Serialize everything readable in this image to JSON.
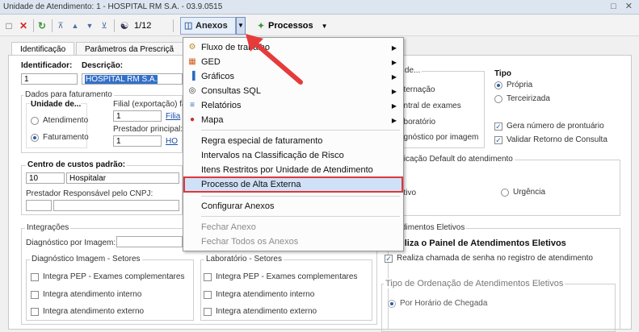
{
  "window": {
    "title": "Unidade de Atendimento: 1 - HOSPITAL RM S.A. - 03.9.0515",
    "controls": "□ ✕"
  },
  "toolbar": {
    "counter": "1/12",
    "anexos_label": "Anexos",
    "processos_label": "Processos"
  },
  "tabs": [
    "Identificação",
    "Parâmetros da Prescriçã"
  ],
  "ident": {
    "identificador_label": "Identificador:",
    "identificador_value": "1",
    "descricao_label": "Descrição:",
    "descricao_value": "HOSPITAL RM S.A."
  },
  "faturamento": {
    "title": "Dados para faturamento",
    "unidade_label": "Unidade de...",
    "atendimento": "Atendimento",
    "faturamento": "Faturamento",
    "filial_label": "Filial (exportação) fa",
    "filial_value": "1",
    "filial_link": "Filia",
    "prestador_label": "Prestador principal:",
    "prestador_value": "1",
    "prestador_link": "HO"
  },
  "centro": {
    "title": "Centro de custos padrão:",
    "code": "10",
    "name": "Hospitalar",
    "prest_label": "Prestador Responsável pelo CNPJ:"
  },
  "integracoes": {
    "title": "Integrações",
    "diag_label": "Diagnóstico por Imagem:",
    "diag_setores": "Diagnóstico Imagem - Setores",
    "lab_setores": "Laboratório - Setores",
    "items_left": [
      "Integra PEP - Exames complementares",
      "Integra atendimento interno",
      "Integra atendimento externo"
    ],
    "items_right": [
      "Integra PEP - Exames complementares",
      "Integra atendimento interno",
      "Integra atendimento externo"
    ]
  },
  "right": {
    "unidade_title": "de de...",
    "unidade_opts": [
      "nternação",
      "entral de exames",
      "aboratório",
      "agnóstico por imagem"
    ],
    "tipo_title": "Tipo",
    "tipo_opts": [
      "Própria",
      "Terceirizada"
    ],
    "checks": [
      "Gera número de prontuário",
      "Validar Retorno de Consulta"
    ],
    "classif_title": "ficação Default do atendimento",
    "eletivo": "etivo",
    "urgencia": "Urgência",
    "eletivos_title": "dimentos Eletivos",
    "painel_label": "tiliza o Painel de Atendimentos Eletivos",
    "chamada_label": "Realiza chamada de senha no registro de atendimento",
    "ordenacao_title": "Tipo de Ordenação de Atendimentos Eletivos",
    "chegada": "Por Horário de Chegada"
  },
  "menu": {
    "items": [
      {
        "label": "Fluxo de trabalho",
        "icon": "workflow-icon",
        "glyph": "⚙",
        "sub": true
      },
      {
        "label": "GED",
        "icon": "ged-icon",
        "glyph": "▦",
        "sub": true
      },
      {
        "label": "Gráficos",
        "icon": "chart-icon",
        "glyph": "▐",
        "sub": true
      },
      {
        "label": "Consultas SQL",
        "icon": "sql-icon",
        "glyph": "◎",
        "sub": true
      },
      {
        "label": "Relatórios",
        "icon": "report-icon",
        "glyph": "≡",
        "sub": true
      },
      {
        "label": "Mapa",
        "icon": "map-pin-icon",
        "glyph": "●",
        "sub": true
      },
      {
        "label": "Regra especial de faturamento"
      },
      {
        "label": "Intervalos na Classificação de Risco"
      },
      {
        "label": "Itens Restritos por Unidade de Atendimento"
      },
      {
        "label": "Processo de Alta Externa"
      },
      {
        "label": "Configurar Anexos"
      },
      {
        "label": "Fechar Anexo"
      },
      {
        "label": "Fechar Todos os Anexos"
      }
    ]
  },
  "colors": {
    "highlight_border": "#e0363a",
    "arrow": "#e63b3b",
    "accent": "#2a5fb0"
  }
}
